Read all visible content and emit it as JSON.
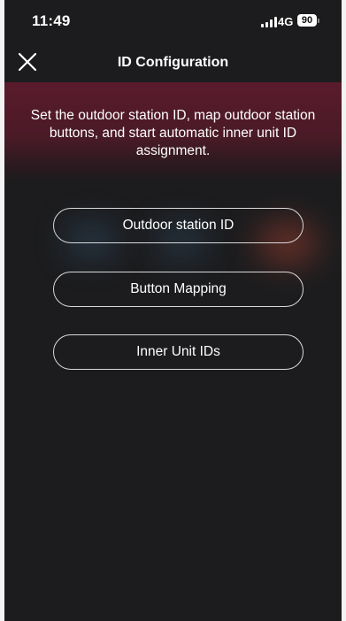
{
  "status_bar": {
    "time": "11:49",
    "network": "4G",
    "battery": "90"
  },
  "header": {
    "title": "ID Configuration",
    "close_icon": "close-icon"
  },
  "description": "Set the outdoor station ID, map outdoor station buttons, and start automatic inner unit ID assignment.",
  "menu": {
    "items": [
      {
        "label": "Outdoor station ID"
      },
      {
        "label": "Button Mapping"
      },
      {
        "label": "Inner Unit IDs"
      }
    ]
  },
  "colors": {
    "background": "#1c1c1e",
    "banner": "#5a1b2c",
    "button_border": "#d9d9d9",
    "text": "#ffffff"
  }
}
